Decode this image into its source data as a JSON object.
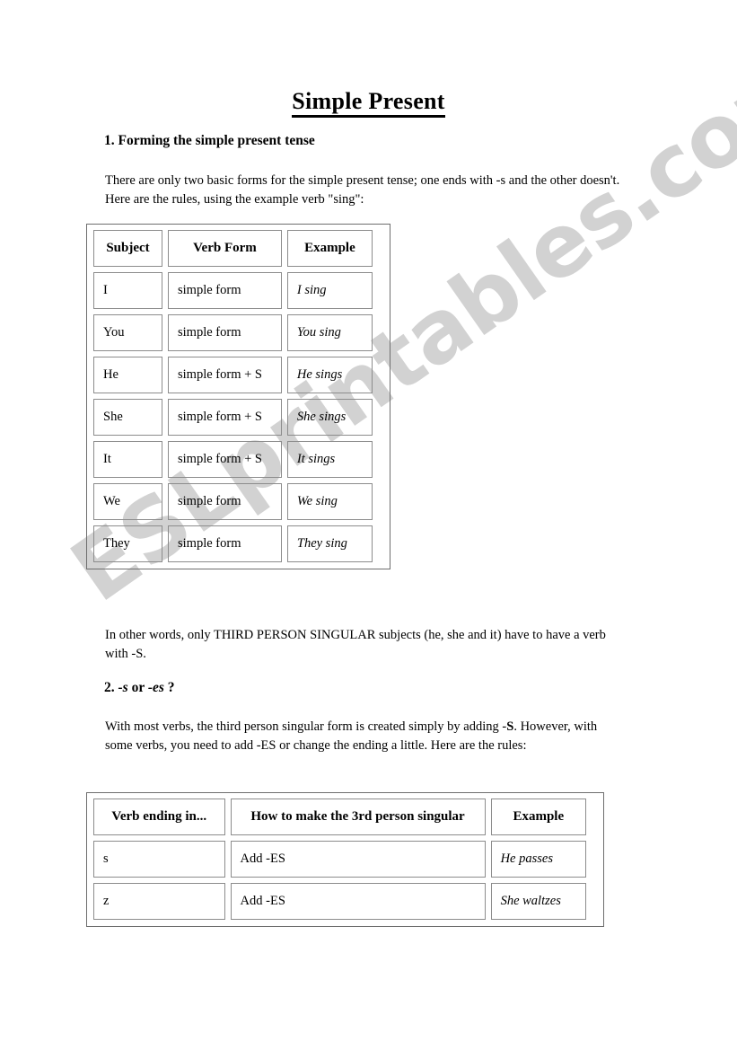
{
  "document": {
    "title": "Simple Present",
    "watermark": "ESLprintables.com",
    "watermark_color": "#d2d2d2"
  },
  "sections": [
    {
      "heading": "1. Forming the simple present tense",
      "intro": "There are only two basic forms for the simple present tense; one ends with -s and the other doesn't. Here are the rules, using the example verb \"sing\":"
    },
    {
      "heading": "2. -s or -es ?",
      "intro": "With most verbs, the third person singular form is created simply by adding -S. However, with some verbs, you need to add -ES or change the ending a little. Here are the rules:"
    }
  ],
  "note_third_person": "In other words, only THIRD PERSON SINGULAR subjects (he, she and it) have to have a verb with -S.",
  "table_subjects": {
    "headers": [
      "Subject",
      "Verb Form",
      "Example"
    ],
    "rows": [
      [
        "I",
        "simple form",
        "I sing"
      ],
      [
        "You",
        "simple form",
        "You sing"
      ],
      [
        "He",
        "simple form + S",
        "He sings"
      ],
      [
        "She",
        "simple form + S",
        "She sings"
      ],
      [
        "It",
        "simple form + S",
        "It sings"
      ],
      [
        "We",
        "simple form",
        "We sing"
      ],
      [
        "They",
        "simple form",
        "They sing"
      ]
    ]
  },
  "table_endings": {
    "headers": [
      "Verb ending in...",
      "How to make the 3rd person singular",
      "Example"
    ],
    "rows": [
      [
        "s",
        "Add -ES",
        "He passes"
      ],
      [
        "z",
        "Add -ES",
        "She waltzes"
      ]
    ]
  }
}
